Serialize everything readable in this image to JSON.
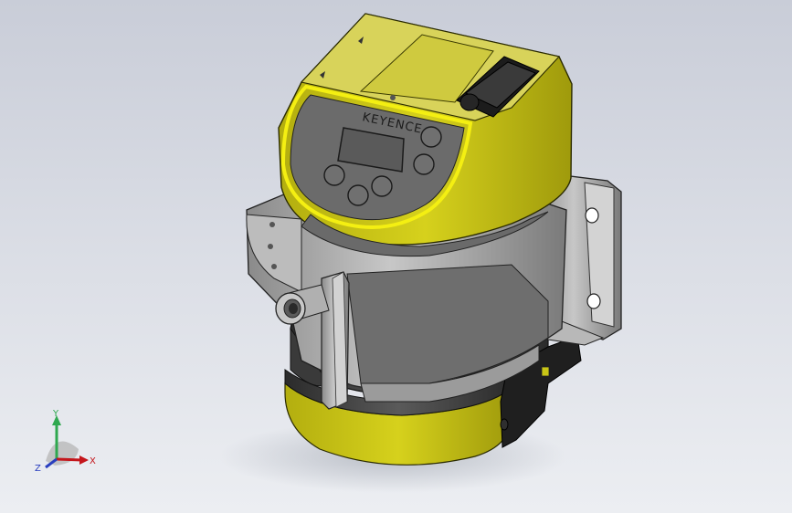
{
  "viewport": {
    "background_top": "#c9cdd8",
    "background_bottom": "#eceef2"
  },
  "model": {
    "brand_label": "KEYENCE",
    "body_color": "#c9c516",
    "panel_color": "#6b6b6b",
    "metal_color": "#a6a6a6"
  },
  "triad": {
    "x_label": "X",
    "y_label": "Y",
    "z_label": "Z",
    "x_color": "#c4161c",
    "y_color": "#2fa84f",
    "z_color": "#2a3fbf"
  }
}
